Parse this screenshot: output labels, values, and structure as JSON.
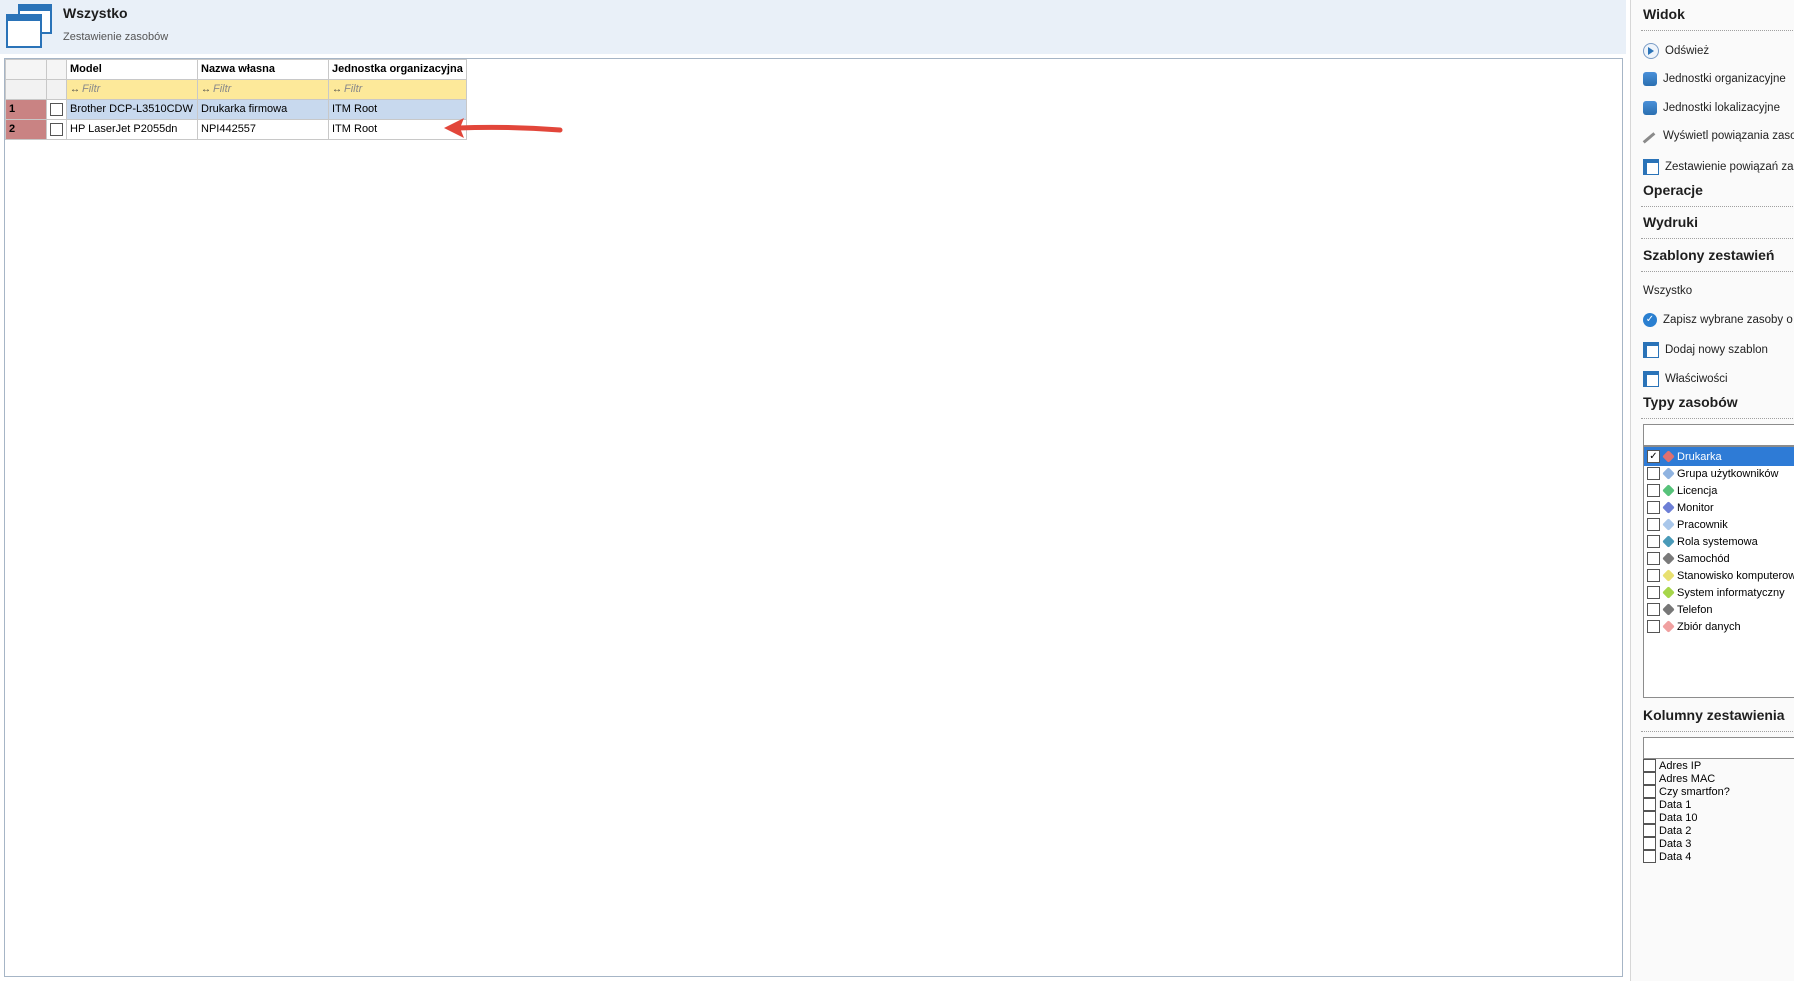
{
  "header": {
    "title": "Wszystko",
    "subtitle": "Zestawienie zasobów"
  },
  "grid": {
    "columns": [
      "Model",
      "Nazwa własna",
      "Jednostka organizacyjna"
    ],
    "filter_placeholder": "Filtr",
    "rows": [
      {
        "num": "1",
        "model": "Brother DCP-L3510CDW",
        "name": "Drukarka firmowa",
        "unit": "ITM Root"
      },
      {
        "num": "2",
        "model": "HP LaserJet P2055dn",
        "name": "NPI442557",
        "unit": "ITM Root"
      }
    ]
  },
  "panel": {
    "widok": {
      "title": "Widok",
      "items": [
        "Odśwież",
        "Jednostki organizacyjne",
        "Jednostki lokalizacyjne",
        "Wyświetl powiązania zasobów",
        "Zestawienie powiązań zasobów"
      ]
    },
    "operacje": {
      "title": "Operacje"
    },
    "wydruki": {
      "title": "Wydruki"
    },
    "szablony": {
      "title": "Szablony zestawień",
      "current": "Wszystko",
      "items": [
        "Zapisz wybrane zasoby o",
        "Dodaj nowy szablon",
        "Właściwości"
      ]
    },
    "typy": {
      "title": "Typy zasobów",
      "items": [
        {
          "label": "Drukarka",
          "checked": true,
          "color": "#e07070"
        },
        {
          "label": "Grupa użytkowników",
          "checked": false,
          "color": "#8fb3e0"
        },
        {
          "label": "Licencja",
          "checked": false,
          "color": "#57c27a"
        },
        {
          "label": "Monitor",
          "checked": false,
          "color": "#6d7fd6"
        },
        {
          "label": "Pracownik",
          "checked": false,
          "color": "#a9c7ea"
        },
        {
          "label": "Rola systemowa",
          "checked": false,
          "color": "#4a9ab8"
        },
        {
          "label": "Samochód",
          "checked": false,
          "color": "#7a7a7a"
        },
        {
          "label": "Stanowisko komputerowe",
          "checked": false,
          "color": "#e8e070"
        },
        {
          "label": "System informatyczny",
          "checked": false,
          "color": "#a6d64a"
        },
        {
          "label": "Telefon",
          "checked": false,
          "color": "#777777"
        },
        {
          "label": "Zbiór danych",
          "checked": false,
          "color": "#f0a0a0"
        }
      ]
    },
    "kolumny": {
      "title": "Kolumny zestawienia",
      "items": [
        "Adres IP",
        "Adres MAC",
        "Czy smartfon?",
        "Data 1",
        "Data 10",
        "Data 2",
        "Data 3",
        "Data 4"
      ]
    }
  }
}
